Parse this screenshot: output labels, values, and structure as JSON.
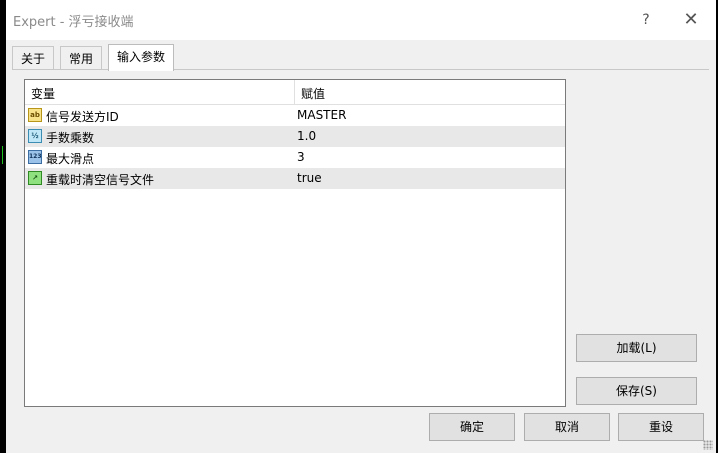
{
  "window": {
    "title": "Expert - 浮亏接收端",
    "help_label": "?",
    "close_label": "✕"
  },
  "tabs": [
    {
      "label": "关于",
      "active": false
    },
    {
      "label": "常用",
      "active": false
    },
    {
      "label": "输入参数",
      "active": true
    }
  ],
  "grid": {
    "columns": [
      "变量",
      "赋值"
    ],
    "rows": [
      {
        "icon": "ab",
        "icon_text": "ab",
        "name": "信号发送方ID",
        "value": "MASTER"
      },
      {
        "icon": "frac",
        "icon_text": "½",
        "name": "手数乘数",
        "value": "1.0"
      },
      {
        "icon": "num",
        "icon_text": "123",
        "name": "最大滑点",
        "value": "3"
      },
      {
        "icon": "bool",
        "icon_text": "↗",
        "name": "重载时清空信号文件",
        "value": "true"
      }
    ]
  },
  "buttons": {
    "load": "加载(L)",
    "save": "保存(S)",
    "ok": "确定",
    "cancel": "取消",
    "reset": "重设"
  },
  "colors": {
    "dialog_bg": "#f0f0f0",
    "title_text": "#8a8a8a",
    "alt_row": "#e8e8e8",
    "chart_green": "#1fbf1f"
  }
}
